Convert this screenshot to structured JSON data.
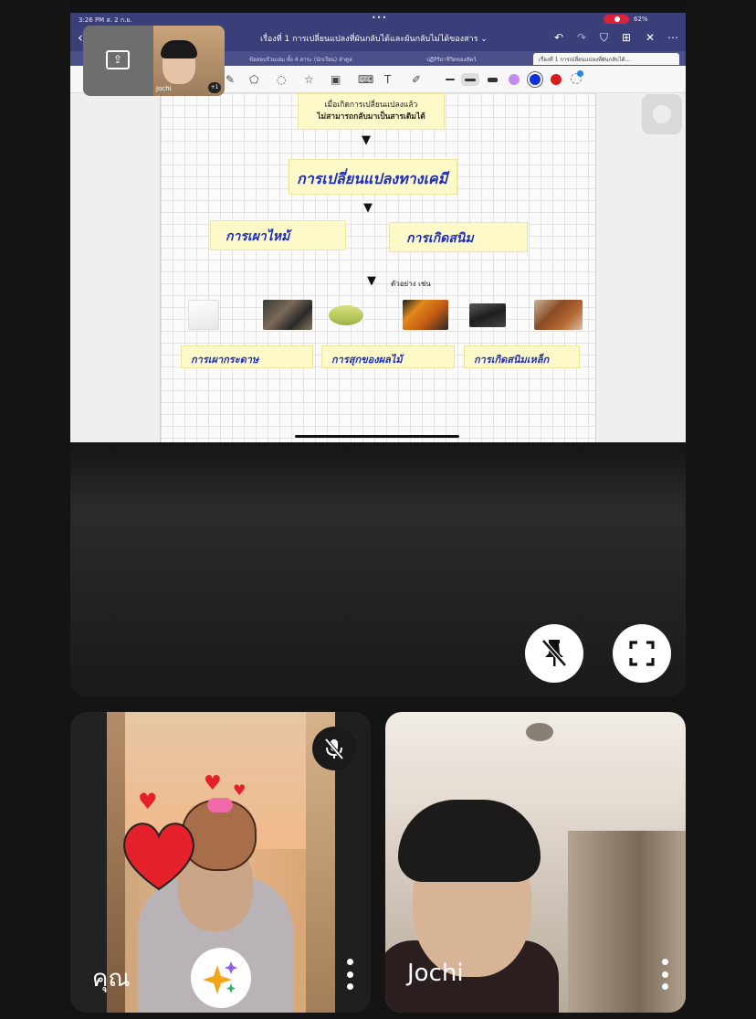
{
  "screen_share": {
    "status_bar": {
      "time": "3:26 PM  ส. 2 ก.ย.",
      "dots": "•••",
      "battery": "62%"
    },
    "doc_title": "เรื่องที่ 1 การเปลี่ยนแปลงที่ผันกลับได้และผันกลับไม่ได้ของสาร ⌄",
    "tabs": [
      {
        "label": "ข้อสอบร้วมเล่ม ทั้ง 4 สาระ (นักเรียน) ลำดูล"
      },
      {
        "label": "ปฏิกิริยาชีวิตของสัตว์"
      },
      {
        "label": "เรื่องที่ 1 การเปลี่ยนแปลงที่ผันกลับได้..."
      }
    ],
    "colors": {
      "purple": "#c58cf0",
      "blue": "#1230d8",
      "red": "#d91c1c",
      "ink": "#1d2fb7",
      "note": "#fdf9c8"
    },
    "whiteboard": {
      "box1_line1": "เมื่อเกิดการเปลี่ยนแปลงแล้ว",
      "box1_line2": "ไม่สามารถกลับมาเป็นสารเดิมได้",
      "box2": "การเปลี่ยนแปลงทางเคมี",
      "box3": "การเผาไหม้",
      "box4": "การเกิดสนิม",
      "example_label": "ตัวอย่าง เช่น",
      "bottom1": "การเผากระดาษ",
      "bottom2": "การสุกของผลไม้",
      "bottom3": "การเกิดสนิมเหล็ก"
    },
    "pip": {
      "name": "Jochi",
      "badge": "+1"
    }
  },
  "controls": {
    "unpin_icon": "pin-off-icon",
    "fullscreen_icon": "fullscreen-icon"
  },
  "participants": [
    {
      "name": "คุณ",
      "muted": true
    },
    {
      "name": "Jochi",
      "muted": false
    }
  ]
}
